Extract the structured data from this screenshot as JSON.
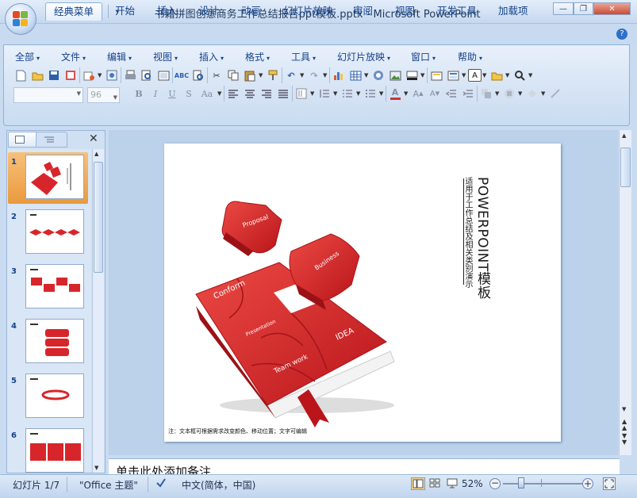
{
  "window": {
    "title": "书籍拼图创意商务工作总结报告ppt模板.pptx - Microsoft PowerPoint",
    "controls": [
      "minimize",
      "restore",
      "close"
    ]
  },
  "quick_access": {
    "icons": [
      "save-icon",
      "undo-icon",
      "redo-icon",
      "customize-icon"
    ]
  },
  "ribbon_tabs": [
    {
      "label": "经典菜单",
      "active": true
    },
    {
      "label": "开始"
    },
    {
      "label": "插入"
    },
    {
      "label": "设计"
    },
    {
      "label": "动画"
    },
    {
      "label": "幻灯片放映"
    },
    {
      "label": "审阅"
    },
    {
      "label": "视图"
    },
    {
      "label": "开发工具"
    },
    {
      "label": "加载项"
    }
  ],
  "classic_menu": [
    "全部",
    "文件",
    "编辑",
    "视图",
    "插入",
    "格式",
    "工具",
    "幻灯片放映",
    "窗口",
    "帮助"
  ],
  "format_bar": {
    "font_value": "",
    "size_value": "96",
    "buttons": [
      "B",
      "I",
      "U",
      "S",
      "Aa"
    ]
  },
  "thumbnails": [
    {
      "num": "1",
      "selected": true
    },
    {
      "num": "2"
    },
    {
      "num": "3"
    },
    {
      "num": "4"
    },
    {
      "num": "5"
    },
    {
      "num": "6"
    }
  ],
  "slide": {
    "title_vertical": "POWERPOINT模板",
    "subtitle_vertical": "适用于工作总结及相关类别演示",
    "puzzle_labels": [
      "Proposal",
      "Business",
      "Conform",
      "Presentation",
      "IDEA",
      "Team work"
    ],
    "footnote": "注：文本框可根据需求改变颜色、移动位置；文字可编辑"
  },
  "notes": {
    "placeholder": "单击此处添加备注"
  },
  "status": {
    "slide_info": "幻灯片 1/7",
    "theme": "\"Office 主题\"",
    "language": "中文(简体，中国)",
    "zoom": "52%"
  },
  "colors": {
    "accent_red": "#d7262b",
    "dark_red": "#a8141a",
    "ribbon_blue": "#15428b"
  }
}
